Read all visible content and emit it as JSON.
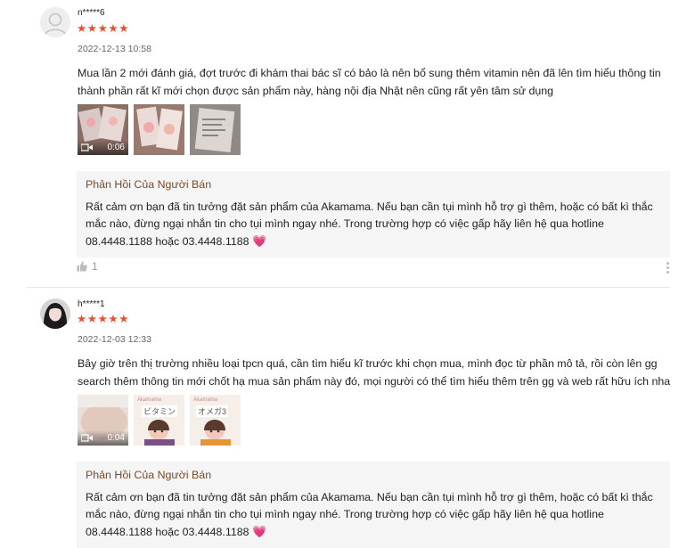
{
  "reviews": [
    {
      "username": "n*****6",
      "stars": "★★★★★",
      "rating": 5,
      "date": "2022-12-13 10:58",
      "text": "Mua lần 2 mới đánh giá, đợt trước đi khám thai bác sĩ có bảo là nên bổ sung thêm vitamin nên đã lên tìm hiểu thông tin thành phần rất kĩ mới chọn được sản phẩm này, hàng nội địa Nhật nên cũng rất yên tâm sử dụng",
      "video_duration": "0:06",
      "seller_reply_title": "Phản Hồi Của Người Bán",
      "seller_reply": "Rất cảm ơn bạn đã tin tưởng đặt sản phẩm của Akamama. Nếu bạn cần tụi mình hỗ trợ gì thêm, hoặc có bất kì thắc mắc nào, đừng ngại nhắn tin cho tụi mình ngay nhé. Trong trường hợp có việc gấp hãy liên hệ qua hotline 08.4448.1188 hoặc 03.4448.1188",
      "heart": "💗",
      "likes": "1"
    },
    {
      "username": "h*****1",
      "stars": "★★★★★",
      "rating": 5,
      "date": "2022-12-03 12:33",
      "text": "Bây giờ trên thị trường nhiều loại tpcn quá, cần tìm hiểu kĩ trước khi chọn mua, mình đọc từ phần mô tả, rồi còn lên gg search thêm thông tin mới chốt hạ mua sản phẩm này đó, mọi người có thể tìm hiểu thêm trên gg và web rất hữu ích nha",
      "video_duration": "0:04",
      "product_label_1": "ビタミン",
      "product_label_2": "オメガ3",
      "brand_label": "Akamama",
      "seller_reply_title": "Phản Hồi Của Người Bán",
      "seller_reply": "Rất cảm ơn bạn đã tin tưởng đặt sản phẩm của Akamama. Nếu bạn cần tụi mình hỗ trợ gì thêm, hoặc có bất kì thắc mắc nào, đừng ngại nhắn tin cho tụi mình ngay nhé. Trong trường hợp có việc gấp hãy liên hệ qua hotline 08.4448.1188 hoặc 03.4448.1188",
      "heart": "💗"
    }
  ],
  "colors": {
    "star": "#ee4d2d",
    "seller_title": "#7a4a2a",
    "reply_bg": "#f5f5f5"
  },
  "icons": [
    "default-avatar-icon",
    "video-camera-icon",
    "thumbs-up-icon",
    "more-vertical-icon",
    "heart-icon"
  ]
}
